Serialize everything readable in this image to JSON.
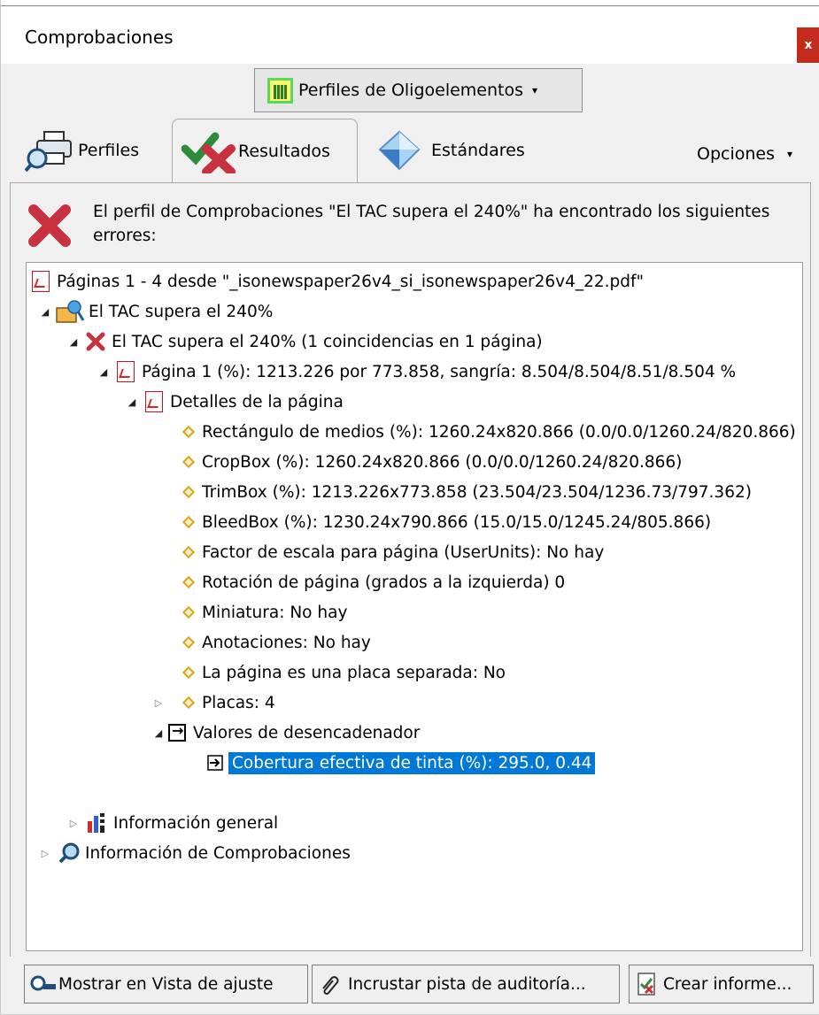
{
  "window": {
    "title": "Comprobaciones",
    "close_label": "x"
  },
  "profile_dropdown": {
    "label": "Perfiles de Oligoelementos",
    "caret": "▾"
  },
  "tabs": [
    {
      "label": "Perfiles",
      "icon": "printer-magnifier-icon"
    },
    {
      "label": "Resultados",
      "icon": "check-cross-icon",
      "active": true
    },
    {
      "label": "Estándares",
      "icon": "diamond-icon"
    }
  ],
  "options": {
    "label": "Opciones",
    "caret": "▾"
  },
  "error_header": {
    "text": "El perfil de Comprobaciones \"El TAC supera el 240%\" ha encontrado los siguientes errores:"
  },
  "tree": {
    "root": "Páginas 1 - 4 desde \"_isonewspaper26v4_si_isonewspaper26v4_22.pdf\"",
    "profile": "El TAC supera el 240%",
    "check": "El TAC supera el 240% (1 coincidencias en 1 página)",
    "page": "Página 1 (%): 1213.226 por 773.858, sangría: 8.504/8.504/8.51/8.504 %",
    "page_details": "Detalles de la página",
    "details": [
      "Rectángulo de medios (%): 1260.24x820.866 (0.0/0.0/1260.24/820.866)",
      "CropBox (%): 1260.24x820.866 (0.0/0.0/1260.24/820.866)",
      "TrimBox (%): 1213.226x773.858 (23.504/23.504/1236.73/797.362)",
      "BleedBox (%): 1230.24x790.866 (15.0/15.0/1245.24/805.866)",
      "Factor de escala para página (UserUnits): No hay",
      "Rotación de página (grados a la izquierda) 0",
      "Miniatura: No hay",
      "Anotaciones: No hay",
      "La página es una placa separada: No"
    ],
    "plates": "Placas: 4",
    "trigger_values": "Valores de desencadenador",
    "trigger_item": "Cobertura efectiva de tinta (%): 295.0, 0.44",
    "general_info": "Información general",
    "check_info": "Información de Comprobaciones"
  },
  "buttons": {
    "show_in_view": "Mostrar en Vista de ajuste",
    "embed_audit": "Incrustar pista de auditoría...",
    "create_report": "Crear informe..."
  },
  "colors": {
    "selection": "#0078d7",
    "error_red": "#c8323f",
    "accent_green": "#59d95b"
  }
}
